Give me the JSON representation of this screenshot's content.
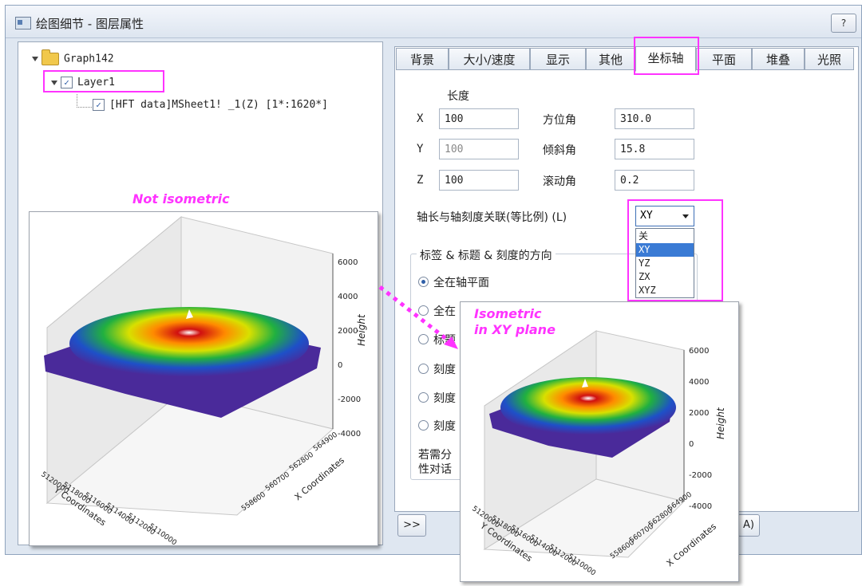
{
  "window": {
    "title": "绘图细节 - 图层属性",
    "help_label": "?"
  },
  "tree": {
    "graph": "Graph142",
    "layer": "Layer1",
    "dataset": "[HFT data]MSheet1! _1(Z) [1*:1620*]"
  },
  "annotations": {
    "not_iso": "Not isometric",
    "iso_line1": "Isometric",
    "iso_line2": "in XY plane"
  },
  "tabs": [
    {
      "label": "背景",
      "active": false
    },
    {
      "label": "大小/速度",
      "active": false
    },
    {
      "label": "显示",
      "active": false
    },
    {
      "label": "其他",
      "active": false
    },
    {
      "label": "坐标轴",
      "active": true
    },
    {
      "label": "平面",
      "active": false
    },
    {
      "label": "堆叠",
      "active": false
    },
    {
      "label": "光照",
      "active": false
    }
  ],
  "axes_tab": {
    "length_header": "长度",
    "x_label": "X",
    "x_value": "100",
    "y_label": "Y",
    "y_value": "100",
    "z_label": "Z",
    "z_value": "100",
    "azimuth_label": "方位角",
    "azimuth_value": "310.0",
    "tilt_label": "倾斜角",
    "tilt_value": "15.8",
    "roll_label": "滚动角",
    "roll_value": "0.2",
    "ratio_label": "轴长与轴刻度关联(等比例) (L)",
    "ratio_selected": "XY",
    "ratio_options": [
      "关",
      "XY",
      "YZ",
      "ZX",
      "XYZ"
    ],
    "orientation_group": "标签 & 标题 & 刻度的方向",
    "orientation_options": [
      "全在轴平面",
      "全在",
      "标题",
      "刻度",
      "刻度",
      "刻度"
    ],
    "note_line1": "若需分",
    "note_line2": "性对话"
  },
  "buttons": {
    "expand": ">>",
    "apply_partial": "A)"
  },
  "plot_left": {
    "z_ticks": [
      "6000",
      "4000",
      "2000",
      "0",
      "-2000",
      "-4000"
    ],
    "z_title": "Height",
    "y_ticks": [
      "5120000",
      "5118000",
      "5116000",
      "5114000",
      "5112000",
      "5110000"
    ],
    "y_title": "Y Coordinates",
    "x_ticks": [
      "564900",
      "562800",
      "560700",
      "558600"
    ],
    "x_title": "X Coordinates"
  },
  "plot_right": {
    "z_ticks": [
      "6000",
      "4000",
      "2000",
      "0",
      "-2000",
      "-4000"
    ],
    "z_title": "Height",
    "y_ticks": [
      "5120000",
      "5118000",
      "5116000",
      "5114000",
      "5112000",
      "5110000"
    ],
    "y_title": "Y Coordinates",
    "x_ticks": [
      "564900",
      "562800",
      "560700",
      "558600"
    ],
    "x_title": "X Coordinates"
  },
  "colors": {
    "highlight": "#ff33ff",
    "selection": "#3a7bd5"
  }
}
